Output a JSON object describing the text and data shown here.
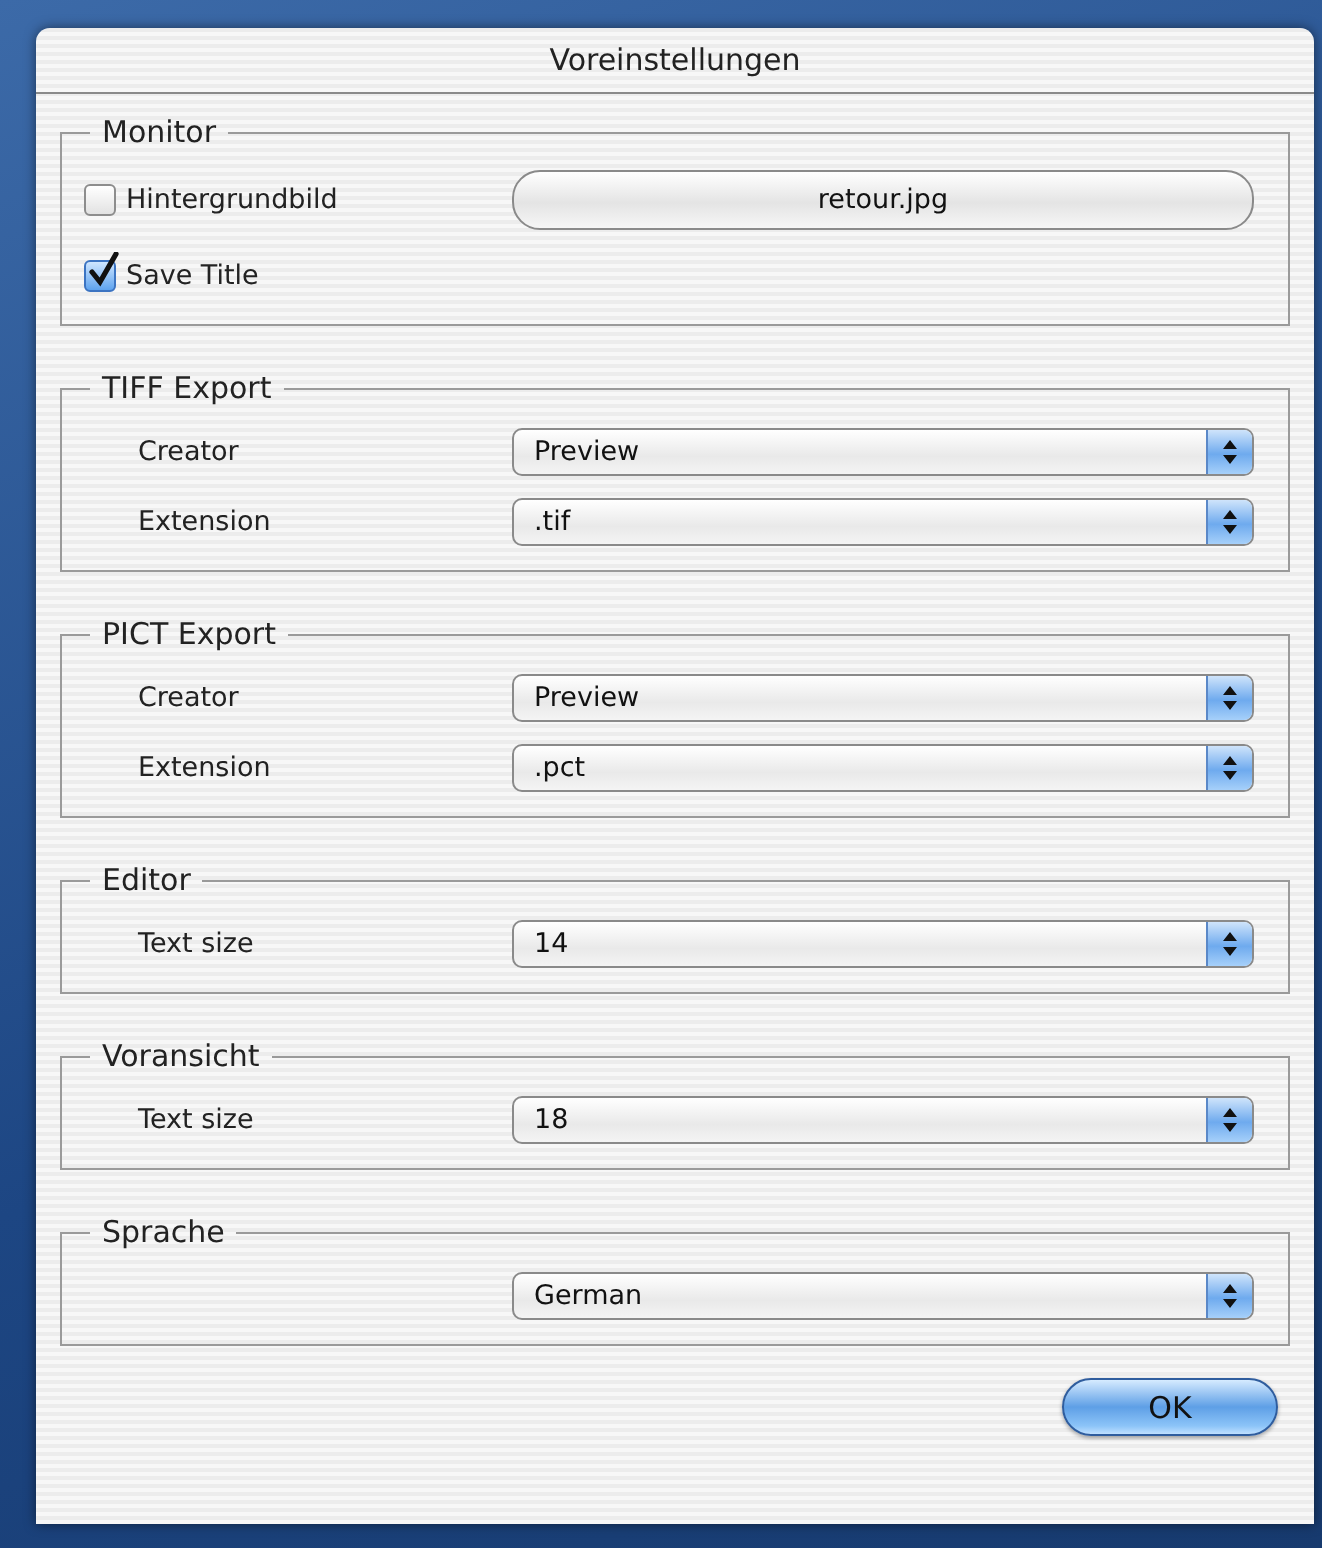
{
  "window": {
    "title": "Voreinstellungen"
  },
  "groups": [
    {
      "title": "Monitor",
      "rows": [
        {
          "kind": "checkbox",
          "label": "Hintergrundbild",
          "checked": false,
          "button": "retour.jpg"
        },
        {
          "kind": "checkbox",
          "label": "Save Title",
          "checked": true
        }
      ]
    },
    {
      "title": "TIFF Export",
      "rows": [
        {
          "kind": "popup",
          "label": "Creator",
          "value": "Preview"
        },
        {
          "kind": "popup",
          "label": "Extension",
          "value": ".tif"
        }
      ]
    },
    {
      "title": "PICT Export",
      "rows": [
        {
          "kind": "popup",
          "label": "Creator",
          "value": "Preview"
        },
        {
          "kind": "popup",
          "label": "Extension",
          "value": ".pct"
        }
      ]
    },
    {
      "title": "Editor",
      "rows": [
        {
          "kind": "popup",
          "label": "Text size",
          "value": "14"
        }
      ]
    },
    {
      "title": "Voransicht",
      "rows": [
        {
          "kind": "popup",
          "label": "Text size",
          "value": "18"
        }
      ]
    },
    {
      "title": "Sprache",
      "rows": [
        {
          "kind": "popup",
          "value": "German"
        }
      ]
    }
  ],
  "buttons": [
    "OK"
  ]
}
